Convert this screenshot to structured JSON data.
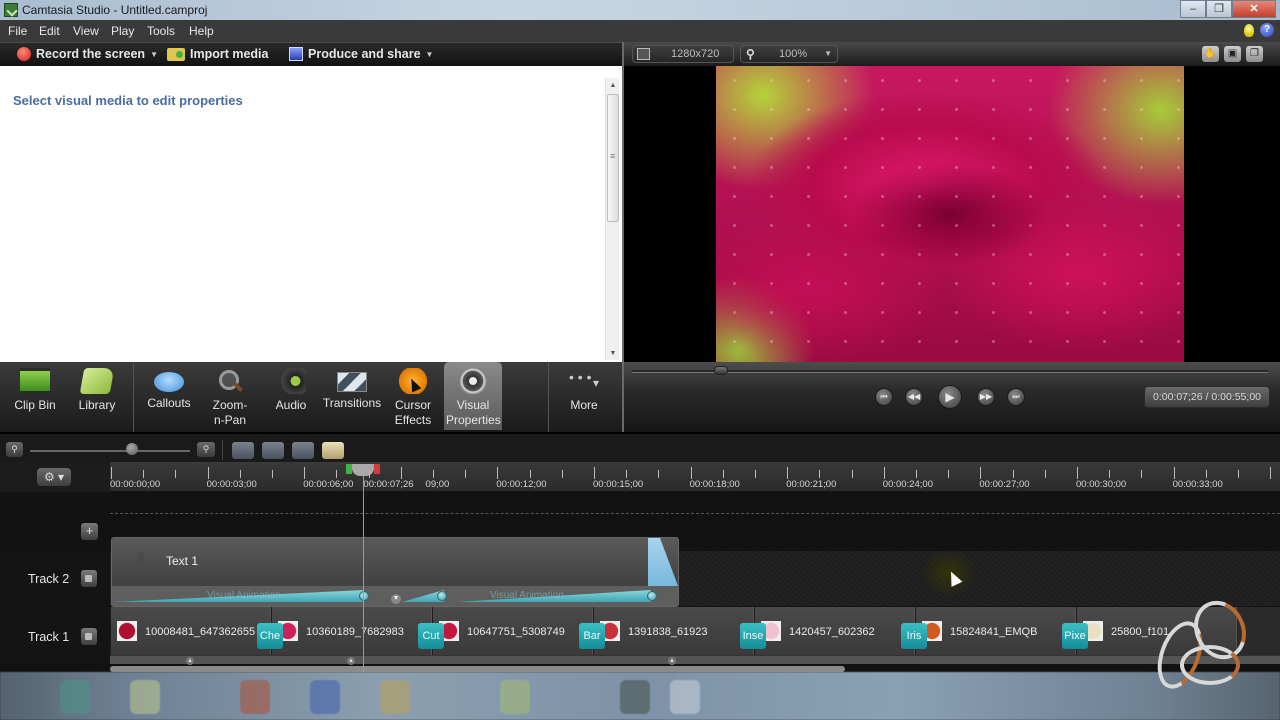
{
  "window": {
    "title": "Camtasia Studio - Untitled.camproj",
    "controls": {
      "minimize": "–",
      "restore": "❐",
      "close": "✕"
    }
  },
  "menu": [
    "File",
    "Edit",
    "View",
    "Play",
    "Tools",
    "Help"
  ],
  "menu_icons": {
    "tip": "lightbulb-icon",
    "help": "?"
  },
  "toolbar": {
    "record": "Record the screen",
    "import": "Import media",
    "produce": "Produce and share"
  },
  "properties": {
    "message": "Select visual media to edit properties"
  },
  "tasks": [
    {
      "label": "Clip Bin",
      "icon": "clip-bin-icon"
    },
    {
      "label": "Library",
      "icon": "library-icon"
    },
    {
      "label": "Callouts",
      "icon": "callouts-icon"
    },
    {
      "label": "Zoom-n-Pan",
      "icon": "zoom-n-pan-icon"
    },
    {
      "label": "Audio",
      "icon": "audio-icon"
    },
    {
      "label": "Transitions",
      "icon": "transitions-icon"
    },
    {
      "label": "Cursor Effects",
      "icon": "cursor-effects-icon"
    },
    {
      "label": "Visual Properties",
      "icon": "visual-properties-icon",
      "active": true
    },
    {
      "label": "More",
      "icon": "more-icon"
    }
  ],
  "preview": {
    "dimensions": "1280x720",
    "zoom": "100%",
    "current_time": "0:00:07;26",
    "total_time": "0:00:55;00",
    "timecode": "0:00:07;26 / 0:00:55;00",
    "scrub_position": 0.14
  },
  "player_buttons": [
    "⏮",
    "◀◀",
    "▶",
    "▶▶",
    "⏭"
  ],
  "timeline": {
    "zoom_level": 0.64,
    "ruler_labels": [
      "00:00:00;00",
      "00:00:03;00",
      "00:00:06;00",
      "00:00:07;26",
      "09;00",
      "00:00:12;00",
      "00:00:15;00",
      "00:00:18;00",
      "00:00:21;00",
      "00:00:24;00",
      "00:00:27;00",
      "00:00:30;00",
      "00:00:33;00"
    ],
    "playhead": "00:00:07;26",
    "tracks": [
      {
        "name": "Track 2",
        "clips": [
          {
            "label": "Text 1",
            "animations": [
              "Visual Animation",
              "Visual Animation"
            ]
          }
        ]
      },
      {
        "name": "Track 1",
        "clips": [
          {
            "label": "10008481_647362655",
            "transition": "Che"
          },
          {
            "label": "10360189_7682983",
            "transition": "Cut"
          },
          {
            "label": "10647751_5308749",
            "transition": "Bar"
          },
          {
            "label": "1391838_61923",
            "transition": "Inse"
          },
          {
            "label": "1420457_602362",
            "transition": "Iris"
          },
          {
            "label": "15824841_EMQB",
            "transition": "Pixe"
          },
          {
            "label": "25800_f101",
            "transition": ""
          }
        ]
      }
    ]
  }
}
